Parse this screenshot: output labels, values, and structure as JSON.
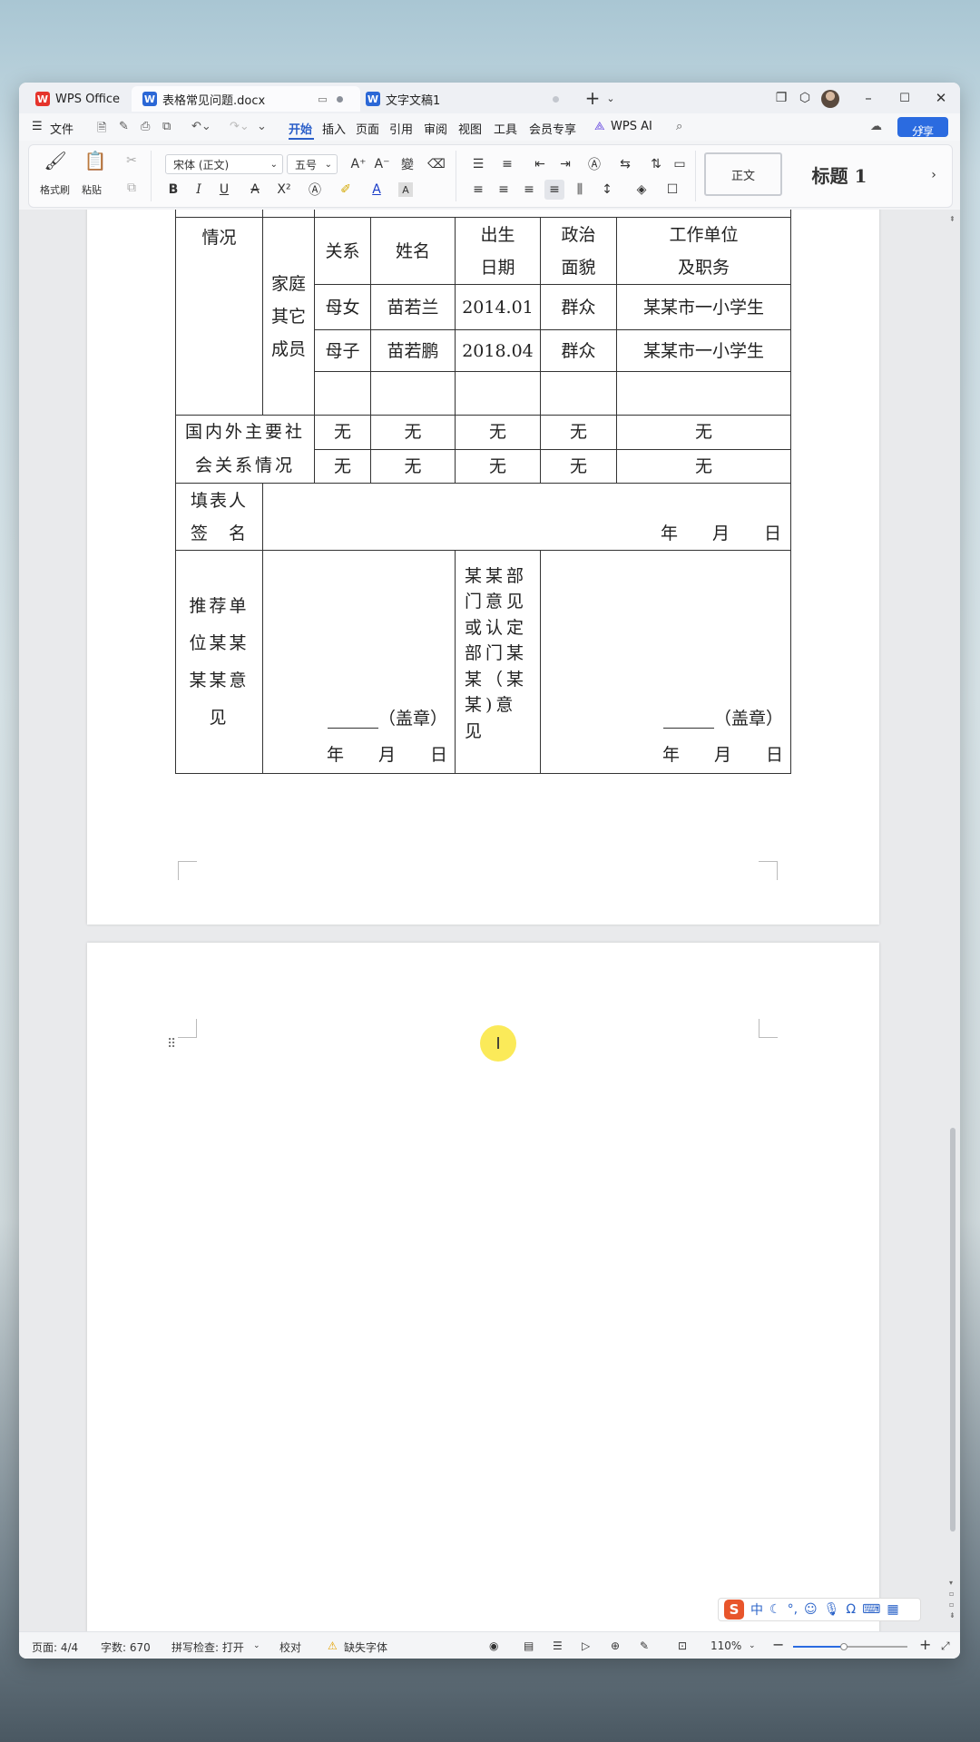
{
  "titlebar": {
    "tabs": [
      {
        "label": "WPS Office",
        "icon": "wps-logo-icon"
      },
      {
        "label": "表格常见问题.docx",
        "icon": "word-doc-icon"
      },
      {
        "label": "文字文稿1",
        "icon": "word-doc-icon"
      }
    ],
    "add_tab": "+"
  },
  "menubar": {
    "file": "文件",
    "items": [
      "开始",
      "插入",
      "页面",
      "引用",
      "审阅",
      "视图",
      "工具",
      "会员专享"
    ],
    "wps_ai": "WPS AI",
    "share": "分享"
  },
  "ribbon": {
    "format_painter": "格式刷",
    "paste": "粘贴",
    "font_name": "宋体 (正文)",
    "font_size": "五号",
    "style_normal": "正文",
    "style_heading1": "标题 1"
  },
  "table": {
    "r1_left": "情况",
    "family_label": "家庭其它成员",
    "header": [
      "关系",
      "姓名",
      "出生日期",
      "政治面貌",
      "工作单位及职务"
    ],
    "rows": [
      [
        "母女",
        "苗若兰",
        "2014.01",
        "群众",
        "某某市一小学生"
      ],
      [
        "母子",
        "苗若鹏",
        "2018.04",
        "群众",
        "某某市一小学生"
      ]
    ],
    "social_label": "国内外主要社会关系情况",
    "social_rows": [
      [
        "无",
        "无",
        "无",
        "无",
        "无"
      ],
      [
        "无",
        "无",
        "无",
        "无",
        "无"
      ]
    ],
    "filler_label": "填表人签　名",
    "date_line": "年　　月　　日",
    "recommend_label": "推荐单位某某某某意见",
    "dept_label": "某某部门意见或认定部门某某（某某)意见",
    "seal": "（盖章）"
  },
  "statusbar": {
    "page": "页面: 4/4",
    "words": "字数: 670",
    "spell": "拼写检查: 打开",
    "proof": "校对",
    "missing_font": "缺失字体",
    "zoom": "110%"
  },
  "ime": {
    "label": "中"
  }
}
